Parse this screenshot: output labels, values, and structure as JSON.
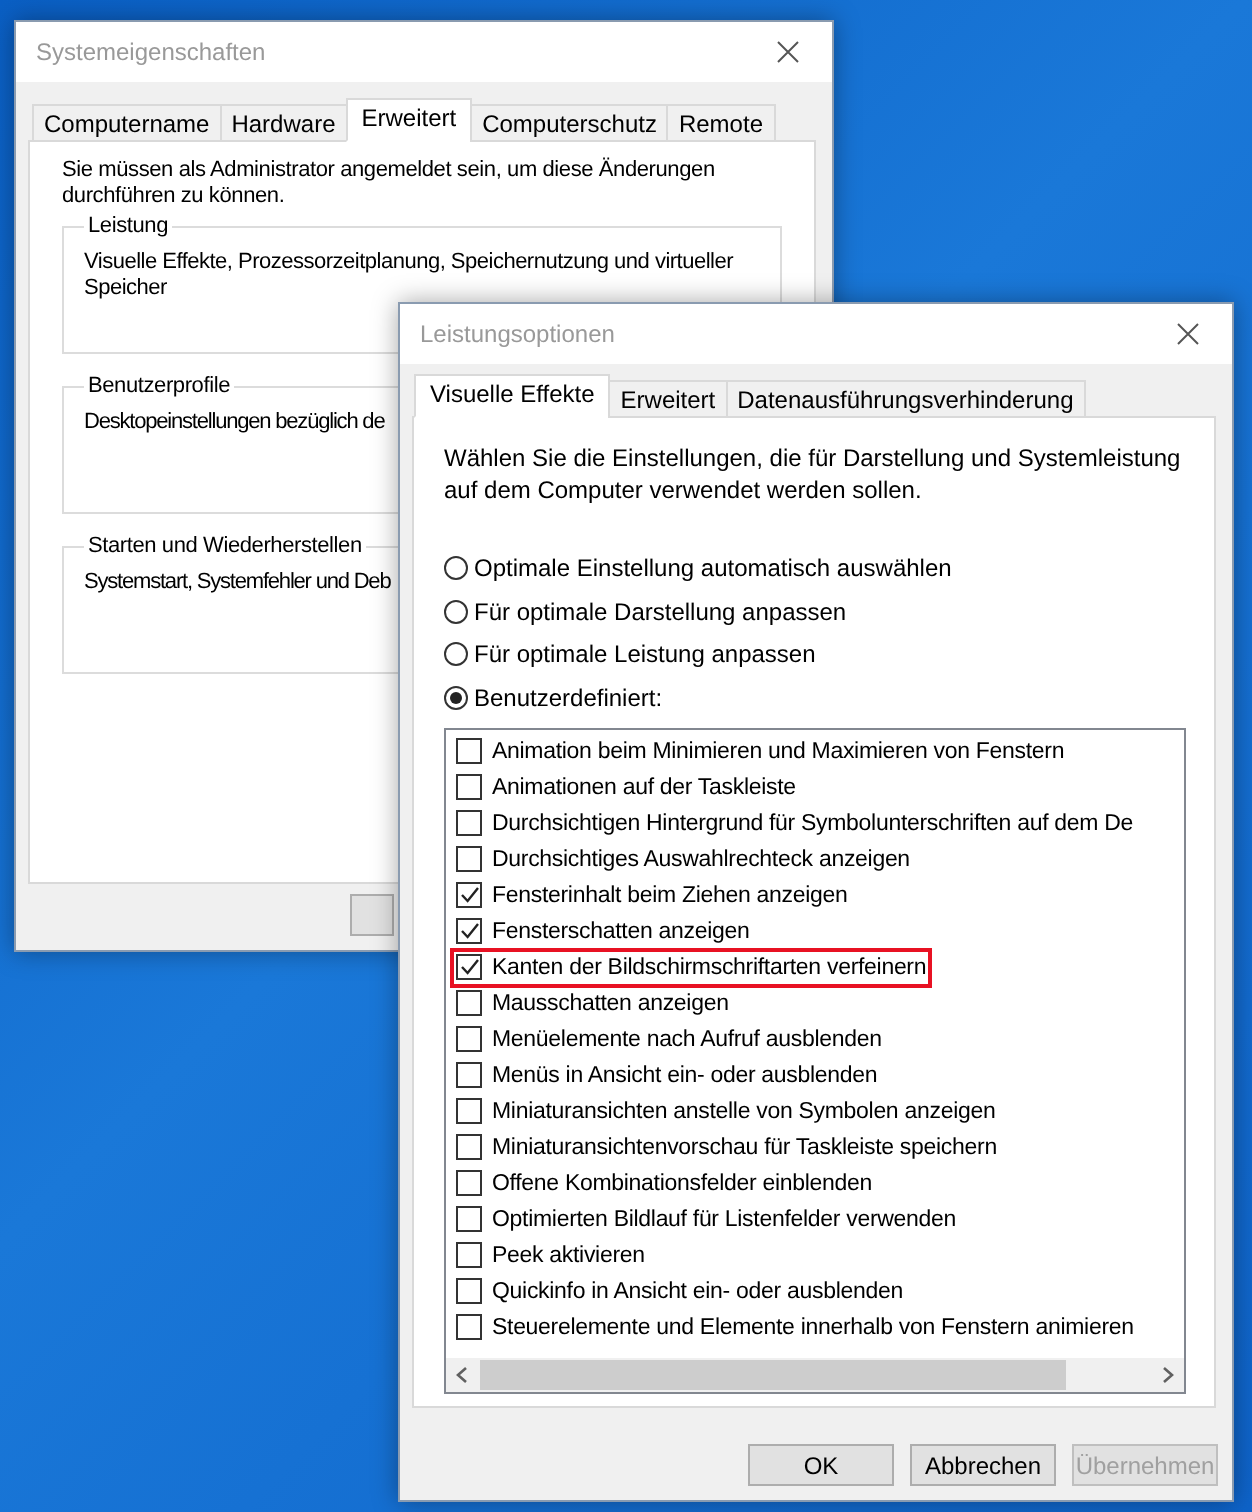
{
  "system_window": {
    "title": "Systemeigenschaften",
    "tabs": [
      {
        "label": "Computername",
        "selected": false
      },
      {
        "label": "Hardware",
        "selected": false
      },
      {
        "label": "Erweitert",
        "selected": true
      },
      {
        "label": "Computerschutz",
        "selected": false
      },
      {
        "label": "Remote",
        "selected": false
      }
    ],
    "notice": "Sie müssen als Administrator angemeldet sein, um diese Änderungen durchführen zu können.",
    "groups": [
      {
        "title": "Leistung",
        "text": "Visuelle Effekte, Prozessorzeitplanung, Speichernutzung und virtueller Speicher"
      },
      {
        "title": "Benutzerprofile",
        "text": "Desktopeinstellungen bezüglich de"
      },
      {
        "title": "Starten und Wiederherstellen",
        "text": "Systemstart, Systemfehler und Deb"
      }
    ]
  },
  "performance_window": {
    "title": "Leistungsoptionen",
    "tabs": [
      {
        "label": "Visuelle Effekte",
        "selected": true
      },
      {
        "label": "Erweitert",
        "selected": false
      },
      {
        "label": "Datenausführungsverhinderung",
        "selected": false
      }
    ],
    "description": "Wählen Sie die Einstellungen, die für Darstellung und Systemleistung auf dem Computer verwendet werden sollen.",
    "options": [
      {
        "label": "Optimale Einstellung automatisch auswählen",
        "selected": false
      },
      {
        "label": "Für optimale Darstellung anpassen",
        "selected": false
      },
      {
        "label": "Für optimale Leistung anpassen",
        "selected": false
      },
      {
        "label": "Benutzerdefiniert:",
        "selected": true
      }
    ],
    "effects": [
      {
        "label": "Animation beim Minimieren und Maximieren von Fenstern",
        "checked": false,
        "highlighted": false
      },
      {
        "label": "Animationen auf der Taskleiste",
        "checked": false,
        "highlighted": false
      },
      {
        "label": "Durchsichtigen Hintergrund für Symbolunterschriften auf dem De",
        "checked": false,
        "highlighted": false
      },
      {
        "label": "Durchsichtiges Auswahlrechteck anzeigen",
        "checked": false,
        "highlighted": false
      },
      {
        "label": "Fensterinhalt beim Ziehen anzeigen",
        "checked": true,
        "highlighted": false
      },
      {
        "label": "Fensterschatten anzeigen",
        "checked": true,
        "highlighted": false
      },
      {
        "label": "Kanten der Bildschirmschriftarten verfeinern",
        "checked": true,
        "highlighted": true
      },
      {
        "label": "Mausschatten anzeigen",
        "checked": false,
        "highlighted": false
      },
      {
        "label": "Menüelemente nach Aufruf ausblenden",
        "checked": false,
        "highlighted": false
      },
      {
        "label": "Menüs in Ansicht ein- oder ausblenden",
        "checked": false,
        "highlighted": false
      },
      {
        "label": "Miniaturansichten anstelle von Symbolen anzeigen",
        "checked": false,
        "highlighted": false
      },
      {
        "label": "Miniaturansichtenvorschau für Taskleiste speichern",
        "checked": false,
        "highlighted": false
      },
      {
        "label": "Offene Kombinationsfelder einblenden",
        "checked": false,
        "highlighted": false
      },
      {
        "label": "Optimierten Bildlauf für Listenfelder verwenden",
        "checked": false,
        "highlighted": false
      },
      {
        "label": "Peek aktivieren",
        "checked": false,
        "highlighted": false
      },
      {
        "label": "Quickinfo in Ansicht ein- oder ausblenden",
        "checked": false,
        "highlighted": false
      },
      {
        "label": "Steuerelemente und Elemente innerhalb von Fenstern animieren",
        "checked": false,
        "highlighted": false
      }
    ],
    "buttons": [
      {
        "label": "OK",
        "disabled": false
      },
      {
        "label": "Abbrechen",
        "disabled": false
      },
      {
        "label": "Übernehmen",
        "disabled": true
      }
    ]
  }
}
